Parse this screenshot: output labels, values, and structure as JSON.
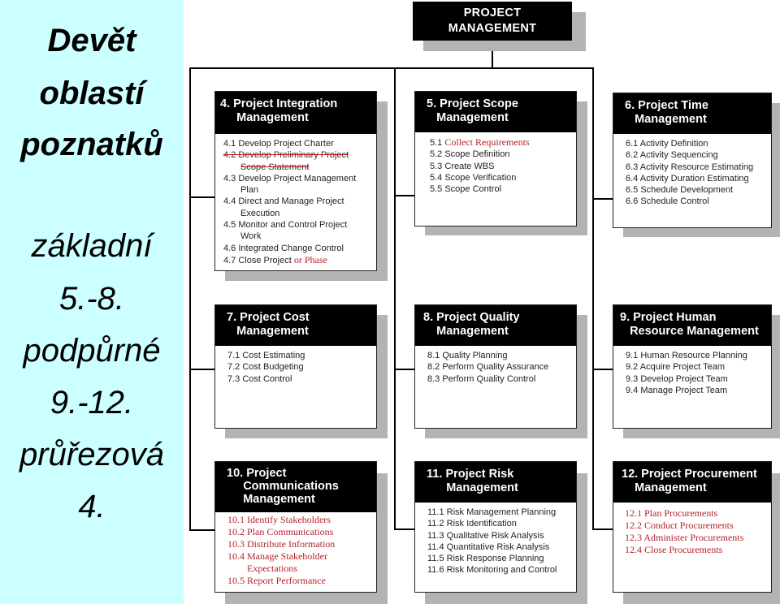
{
  "left_panel": {
    "lines": [
      "Devět",
      "oblastí",
      "poznatků",
      "základní",
      "5.-8.",
      "podpůrné",
      "9.-12.",
      "průřezová",
      "4."
    ]
  },
  "root": {
    "line1": "PROJECT",
    "line2": "MANAGEMENT"
  },
  "boxes": {
    "b4": {
      "title": [
        "4. Project Integration",
        "     Management"
      ],
      "items": [
        {
          "text": "4.1 Develop Project Charter"
        },
        {
          "text": "4.2 Develop Preliminary Project",
          "struck": true
        },
        {
          "text": "Scope Statement",
          "struck": true
        },
        {
          "text": "4.3 Develop Project Management"
        },
        {
          "text": "Plan"
        },
        {
          "text": "4.4 Direct and Manage Project"
        },
        {
          "text": "Execution"
        },
        {
          "text": "4.5 Monitor and Control Project"
        },
        {
          "text": "Work"
        },
        {
          "text": "4.6 Integrated Change Control"
        },
        {
          "text": "4.7 Close Project",
          "addition": "or Phase"
        }
      ]
    },
    "b5": {
      "title": [
        "  5. Project Scope",
        "     Management"
      ],
      "items": [
        {
          "prefix": "5.1 ",
          "text": "Collect Requirements"
        },
        {
          "text": "5.2 Scope Definition"
        },
        {
          "text": "5.3 Create WBS"
        },
        {
          "text": "5.4 Scope Verification"
        },
        {
          "text": "5.5 Scope Control"
        }
      ]
    },
    "b6": {
      "title": [
        "  6. Project Time",
        "     Management"
      ],
      "items": [
        "6.1 Activity Definition",
        "6.2 Activity Sequencing",
        "6.3 Activity Resource Estimating",
        "6.4 Activity Duration Estimating",
        "6.5 Schedule Development",
        "6.6 Schedule Control"
      ]
    },
    "b7": {
      "title": [
        "  7. Project Cost",
        "     Management"
      ],
      "items": [
        "7.1 Cost Estimating",
        "7.2 Cost Budgeting",
        "7.3 Cost Control"
      ]
    },
    "b8": {
      "title": [
        " 8. Project Quality",
        "     Management"
      ],
      "items": [
        "8.1 Quality Planning",
        "8.2 Perform Quality Assurance",
        "8.3 Perform Quality Control"
      ]
    },
    "b9": {
      "title": [
        "9. Project Human",
        "   Resource Management"
      ],
      "items": [
        "9.1 Human Resource Planning",
        "9.2 Acquire Project Team",
        "9.3 Develop Project Team",
        "9.4 Manage Project Team"
      ]
    },
    "b10": {
      "title": [
        "  10. Project",
        "       Communications",
        "       Management"
      ],
      "items": [
        {
          "text": "10.1 Identify Stakeholders"
        },
        {
          "text": "10.2 Plan Communications"
        },
        {
          "text": "10.3 Distribute Information"
        },
        {
          "text": "10.4 Manage Stakeholder"
        },
        {
          "text": "Expectations",
          "indent": true
        },
        {
          "text": "10.5 Report Performance"
        }
      ]
    },
    "b11": {
      "title": [
        "  11. Project Risk",
        "        Management"
      ],
      "items": [
        "11.1 Risk Management Planning",
        "11.2 Risk Identification",
        "11.3 Qualitative Risk Analysis",
        "11.4 Quantitative Risk Analysis",
        "11.5 Risk Response Planning",
        "11.6 Risk Monitoring and Control"
      ]
    },
    "b12": {
      "title": [
        "12. Project Procurement",
        "    Management"
      ],
      "items": [
        "12.1 Plan Procurements",
        "12.2 Conduct Procurements",
        "12.3 Administer Procurements",
        "12.4 Close Procurements"
      ]
    }
  },
  "colors": {
    "left_panel_bg": "#ccffff",
    "header_bg": "#000000",
    "shadow": "#b3b3b3",
    "revision_red": "#b5222a"
  }
}
